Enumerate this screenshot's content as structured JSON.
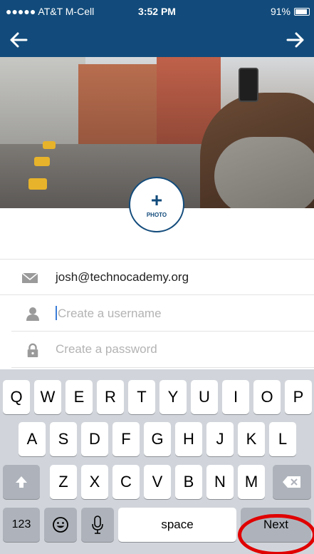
{
  "status_bar": {
    "carrier": "●●●●● AT&T M-Cell",
    "time": "3:52 PM",
    "battery": "91%",
    "battery_level": 0.91
  },
  "nav": {
    "back_icon": "arrow-left-icon",
    "forward_icon": "arrow-right-icon"
  },
  "photo_button": {
    "plus": "+",
    "label": "PHOTO"
  },
  "form": {
    "email_value": "josh@technocademy.org",
    "username_placeholder": "Create a username",
    "password_placeholder": "Create a password"
  },
  "keyboard": {
    "row1": [
      "Q",
      "W",
      "E",
      "R",
      "T",
      "Y",
      "U",
      "I",
      "O",
      "P"
    ],
    "row2": [
      "A",
      "S",
      "D",
      "F",
      "G",
      "H",
      "J",
      "K",
      "L"
    ],
    "row3": [
      "Z",
      "X",
      "C",
      "V",
      "B",
      "N",
      "M"
    ],
    "numbers_label": "123",
    "space_label": "space",
    "next_label": "Next"
  },
  "colors": {
    "brand_blue": "#124b7b",
    "highlight_red": "#e00000",
    "cursor_blue": "#3a7cd8"
  }
}
